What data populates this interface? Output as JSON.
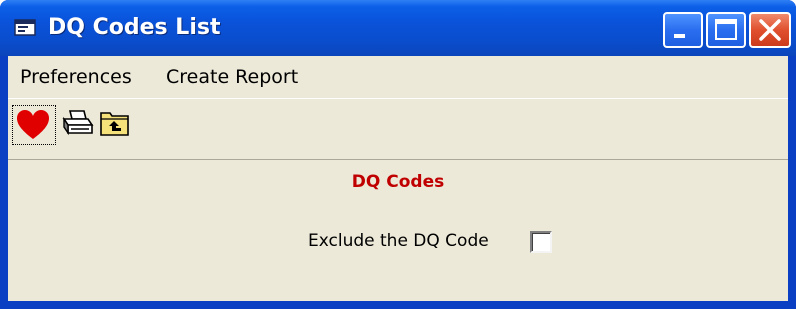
{
  "window": {
    "title": "DQ Codes List",
    "title_icon": "app-window-icon",
    "controls": {
      "minimize_icon": "minimize-icon",
      "maximize_icon": "maximize-icon",
      "close_icon": "close-icon"
    }
  },
  "menu": {
    "items": [
      {
        "label": "Preferences"
      },
      {
        "label": "Create Report"
      }
    ]
  },
  "toolbar": {
    "buttons": [
      {
        "icon": "heart-icon",
        "color": "#e00000"
      },
      {
        "icon": "printer-icon"
      },
      {
        "icon": "folder-up-icon",
        "color": "#f5e27a"
      }
    ]
  },
  "content": {
    "heading": "DQ Codes",
    "heading_color": "#c00000",
    "exclude_label": "Exclude the DQ Code",
    "exclude_checked": false
  },
  "colors": {
    "titlebar": "#0a52d9",
    "client_bg": "#ece9d8",
    "close_button": "#e0502e"
  }
}
